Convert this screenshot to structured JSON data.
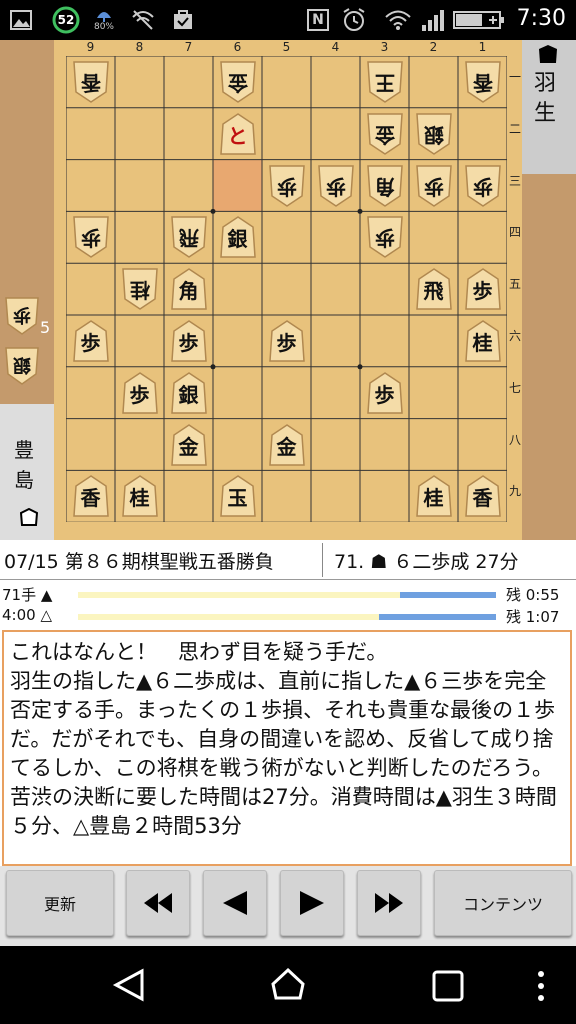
{
  "status_bar": {
    "battery_percent": "52",
    "data_badge": "80%",
    "nfc": "N",
    "time": "7:30"
  },
  "board": {
    "col_labels": [
      "9",
      "8",
      "7",
      "6",
      "5",
      "4",
      "3",
      "2",
      "1"
    ],
    "row_labels": [
      "一",
      "二",
      "三",
      "四",
      "五",
      "六",
      "七",
      "八",
      "九"
    ],
    "pieces": [
      {
        "c": 0,
        "r": 0,
        "k": "香",
        "rev": true
      },
      {
        "c": 3,
        "r": 0,
        "k": "金",
        "rev": true
      },
      {
        "c": 6,
        "r": 0,
        "k": "王",
        "rev": true
      },
      {
        "c": 8,
        "r": 0,
        "k": "香",
        "rev": true
      },
      {
        "c": 3,
        "r": 1,
        "k": "と",
        "promo": true
      },
      {
        "c": 6,
        "r": 1,
        "k": "金",
        "rev": true
      },
      {
        "c": 7,
        "r": 1,
        "k": "銀",
        "rev": true
      },
      {
        "c": 4,
        "r": 2,
        "k": "歩",
        "rev": true
      },
      {
        "c": 5,
        "r": 2,
        "k": "歩",
        "rev": true
      },
      {
        "c": 6,
        "r": 2,
        "k": "角",
        "rev": true
      },
      {
        "c": 7,
        "r": 2,
        "k": "歩",
        "rev": true
      },
      {
        "c": 8,
        "r": 2,
        "k": "歩",
        "rev": true
      },
      {
        "c": 0,
        "r": 3,
        "k": "歩",
        "rev": true
      },
      {
        "c": 2,
        "r": 3,
        "k": "飛",
        "rev": true
      },
      {
        "c": 3,
        "r": 3,
        "k": "銀"
      },
      {
        "c": 6,
        "r": 3,
        "k": "歩",
        "rev": true
      },
      {
        "c": 1,
        "r": 4,
        "k": "桂",
        "rev": true
      },
      {
        "c": 2,
        "r": 4,
        "k": "角"
      },
      {
        "c": 7,
        "r": 4,
        "k": "飛"
      },
      {
        "c": 8,
        "r": 4,
        "k": "歩"
      },
      {
        "c": 0,
        "r": 5,
        "k": "歩"
      },
      {
        "c": 2,
        "r": 5,
        "k": "歩"
      },
      {
        "c": 4,
        "r": 5,
        "k": "歩"
      },
      {
        "c": 8,
        "r": 5,
        "k": "桂"
      },
      {
        "c": 1,
        "r": 6,
        "k": "歩"
      },
      {
        "c": 2,
        "r": 6,
        "k": "銀"
      },
      {
        "c": 6,
        "r": 6,
        "k": "歩"
      },
      {
        "c": 2,
        "r": 7,
        "k": "金"
      },
      {
        "c": 4,
        "r": 7,
        "k": "金"
      },
      {
        "c": 0,
        "r": 8,
        "k": "香"
      },
      {
        "c": 1,
        "r": 8,
        "k": "桂"
      },
      {
        "c": 3,
        "r": 8,
        "k": "玉"
      },
      {
        "c": 7,
        "r": 8,
        "k": "桂"
      },
      {
        "c": 8,
        "r": 8,
        "k": "香"
      }
    ],
    "highlight": {
      "c": 3,
      "r": 2
    }
  },
  "gote": {
    "name_line1": "羽",
    "name_line2": "生"
  },
  "sente": {
    "name_line1": "豊",
    "name_line2": "島"
  },
  "gote_hand": [
    {
      "k": "歩"
    },
    {
      "k": "銀"
    }
  ],
  "gote_hand_count": "5",
  "info": {
    "date_title": "07/15 第８６期棋聖戦五番勝負",
    "move": "71. ☗ ６二歩成 27分"
  },
  "time": {
    "row1_label": "71手 ▲",
    "row1_rest": "残 0:55",
    "row1_fill": 0.23,
    "row2_label": "4:00 △",
    "row2_rest": "残 1:07",
    "row2_fill": 0.28
  },
  "comment": "これはなんと！　思わず目を疑う手だ。\n羽生の指した▲６二歩成は、直前に指した▲６三歩を完全否定する手。まったくの１歩損、それも貴重な最後の１歩だ。だがそれでも、自身の間違いを認め、反省して成り捨てるしか、この将棋を戦う術がないと判断したのだろう。苦渋の決断に要した時間は27分。消費時間は▲羽生３時間５分、△豊島２時間53分",
  "buttons": {
    "refresh": "更新",
    "contents": "コンテンツ"
  }
}
